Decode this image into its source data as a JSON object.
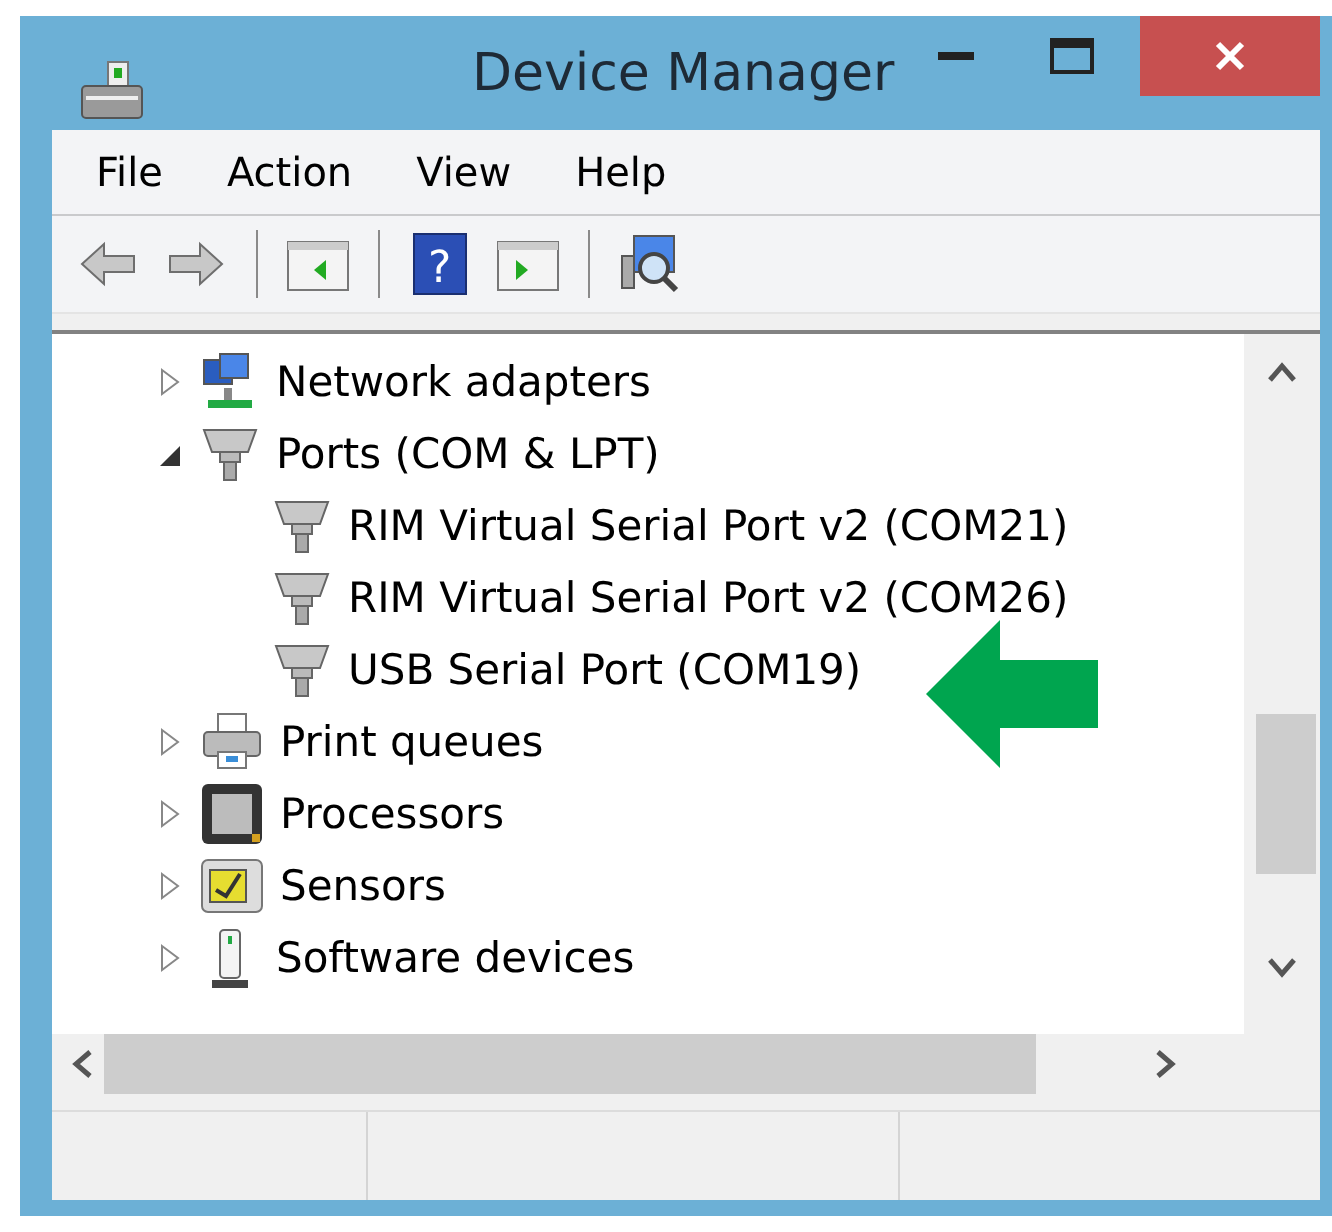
{
  "window": {
    "title": "Device Manager"
  },
  "menu": [
    "File",
    "Action",
    "View",
    "Help"
  ],
  "toolbar": {
    "help_glyph": "?"
  },
  "tree": [
    {
      "label": "Network adapters",
      "kind": "network",
      "expanded": false
    },
    {
      "label": "Ports (COM & LPT)",
      "kind": "port",
      "expanded": true,
      "children": [
        {
          "label": "RIM Virtual Serial Port v2 (COM21)",
          "kind": "port"
        },
        {
          "label": "RIM Virtual Serial Port v2 (COM26)",
          "kind": "port"
        },
        {
          "label": "USB Serial Port (COM19)",
          "kind": "port"
        }
      ]
    },
    {
      "label": "Print queues",
      "kind": "printer",
      "expanded": false
    },
    {
      "label": "Processors",
      "kind": "processor",
      "expanded": false
    },
    {
      "label": "Sensors",
      "kind": "sensor",
      "expanded": false
    },
    {
      "label": "Software devices",
      "kind": "software",
      "expanded": false
    }
  ]
}
